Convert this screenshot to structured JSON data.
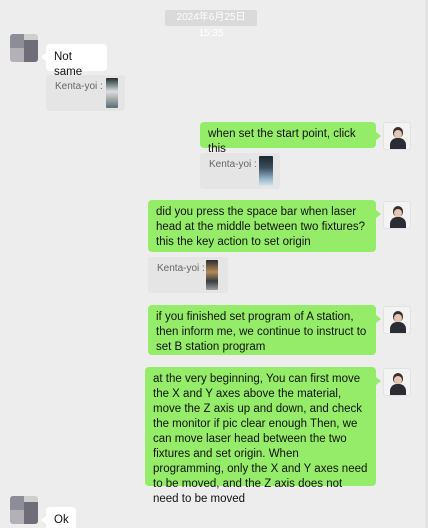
{
  "timestamp": "2024年6月25日 15:35",
  "messages": {
    "m1": "Not same",
    "m2": "when set the start point, click this",
    "m3": "did you press the space bar when laser head at the middle between two fixtures? this the key action to set origin",
    "m4": "if you finished set program of A station, then inform me, we continue to instruct to set B station program",
    "m5": "at the very beginning, You can first move the X and Y axes above the material, move the Z axis up and down, and check the monitor if pic clear enough Then, we can move laser head between the two fixtures and set origin. When programming, only the X and Y axes need to be moved, and the Z axis does not need to be moved",
    "m6": "Ok"
  },
  "quotes": {
    "q1": "Kenta-yoi :",
    "q2": "Kenta-yoi :",
    "q3": "Kenta-yoi :"
  },
  "colors": {
    "background": "#ededed",
    "sent_bubble": "#95ec69",
    "received_bubble": "#ffffff",
    "quote_bg": "#e5e5e5"
  }
}
